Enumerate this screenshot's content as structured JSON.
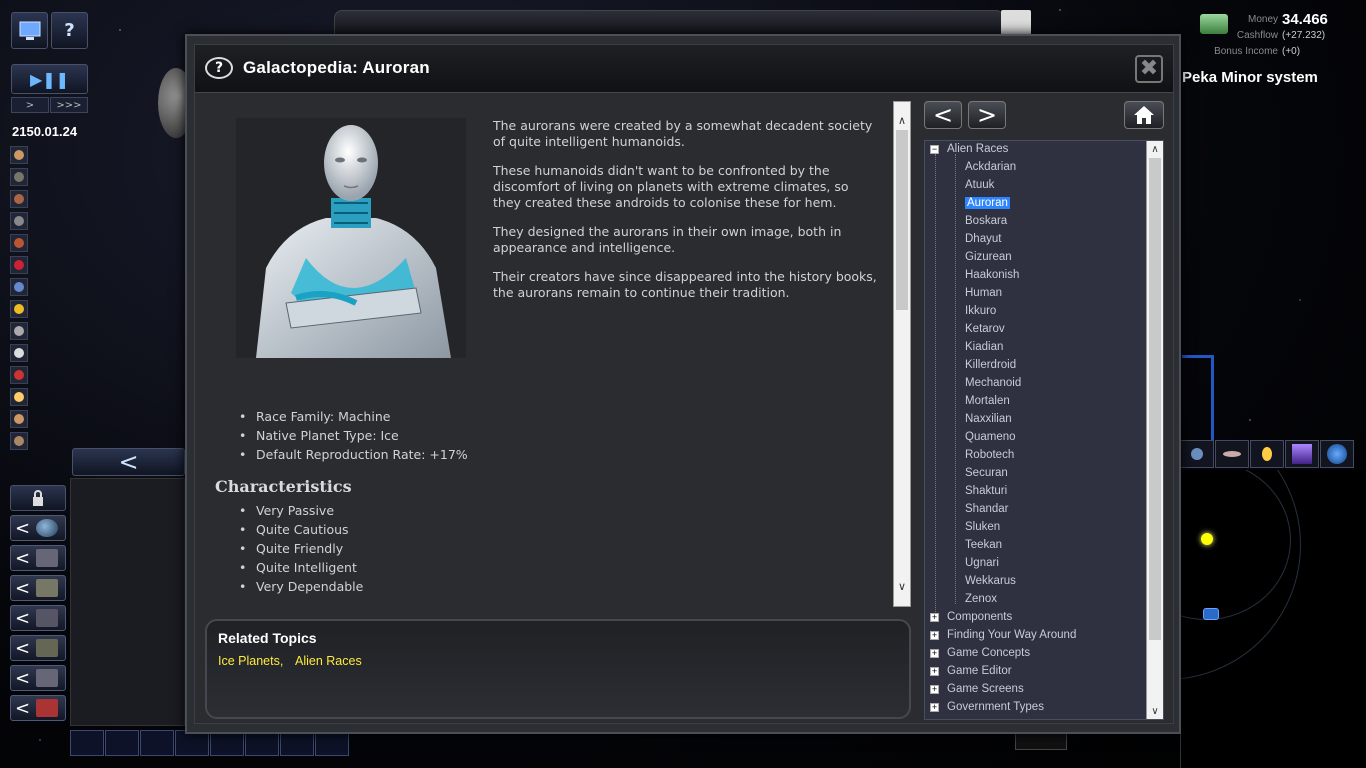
{
  "hud": {
    "date": "2150.01.24",
    "speed_slow": ">",
    "speed_fast": ">>>",
    "play_pause": "▶❚❚",
    "help": "?",
    "money_label": "Money",
    "money_value": "34.466",
    "cashflow_label": "Cashflow",
    "cashflow_value": "(+27.232)",
    "bonus_label": "Bonus Income",
    "bonus_value": "(+0)",
    "system_name": "Peka Minor system",
    "back_arrow": "<"
  },
  "dialog": {
    "title": "Galactopedia: Auroran",
    "help_glyph": "?",
    "close_glyph": "✖",
    "description": [
      "The aurorans were created by a somewhat decadent society of quite intelligent humanoids.",
      "These humanoids didn't want to be confronted by the discomfort of living on planets with extreme climates, so they created these androids to colonise these for hem.",
      "They designed the aurorans in their own image, both in appearance and intelligence.",
      "Their creators have since disappeared into the history books, the aurorans remain to continue their tradition."
    ],
    "facts": [
      "Race Family: Machine",
      "Native Planet Type: Ice",
      "Default Reproduction Rate: +17%"
    ],
    "characteristics_title": "Characteristics",
    "characteristics": [
      "Very Passive",
      "Quite Cautious",
      "Quite Friendly",
      "Quite Intelligent",
      "Very Dependable"
    ],
    "related_title": "Related Topics",
    "related_links": [
      "Ice Planets,",
      "Alien Races"
    ],
    "nav_back": "<",
    "nav_forward": ">",
    "scroll_up": "∧",
    "scroll_down": "∨"
  },
  "tree": {
    "root_label": "Alien Races",
    "root_expander": "−",
    "races": [
      "Ackdarian",
      "Atuuk",
      "Auroran",
      "Boskara",
      "Dhayut",
      "Gizurean",
      "Haakonish",
      "Human",
      "Ikkuro",
      "Ketarov",
      "Kiadian",
      "Killerdroid",
      "Mechanoid",
      "Mortalen",
      "Naxxilian",
      "Quameno",
      "Robotech",
      "Securan",
      "Shakturi",
      "Shandar",
      "Sluken",
      "Teekan",
      "Ugnari",
      "Wekkarus",
      "Zenox"
    ],
    "selected": "Auroran",
    "sections": [
      "Components",
      "Finding Your Way Around",
      "Game Concepts",
      "Game Editor",
      "Game Screens",
      "Government Types"
    ],
    "section_expander": "+"
  },
  "colors": {
    "link": "#ffea3d",
    "selection": "#2e86ff",
    "dialog_bg": "#2a2c30"
  }
}
